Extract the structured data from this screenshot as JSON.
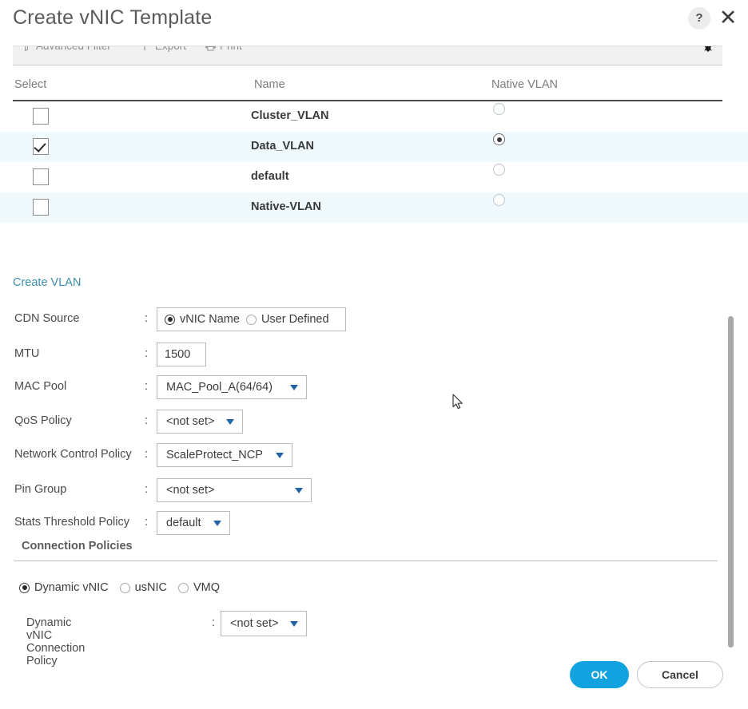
{
  "dialog": {
    "title": "Create vNIC Template",
    "help_icon": "help-circle-icon",
    "help_glyph": "?",
    "close_icon": "close-icon",
    "close_glyph": "✕"
  },
  "toolbar": {
    "advanced_filter": "Advanced Filter",
    "export": "Export",
    "print": "Print",
    "settings_icon": "column-settings-icon"
  },
  "table": {
    "columns": [
      "Select",
      "Name",
      "Native VLAN"
    ],
    "rows": [
      {
        "name": "Cluster_VLAN",
        "selected": false,
        "native": false
      },
      {
        "name": "Data_VLAN",
        "selected": true,
        "native": true
      },
      {
        "name": "default",
        "selected": false,
        "native": false
      },
      {
        "name": "Native-VLAN",
        "selected": false,
        "native": false
      }
    ]
  },
  "links": {
    "create_vlan": "Create VLAN"
  },
  "form": {
    "colon": ":",
    "cdn_source": {
      "label": "CDN Source",
      "options": [
        "vNIC Name",
        "User Defined"
      ],
      "selected": "vNIC Name"
    },
    "mtu": {
      "label": "MTU",
      "value": "1500"
    },
    "mac_pool": {
      "label": "MAC Pool",
      "value": "MAC_Pool_A(64/64)"
    },
    "qos_policy": {
      "label": "QoS Policy",
      "value": "<not set>"
    },
    "network_control_policy": {
      "label": "Network Control Policy",
      "value": "ScaleProtect_NCP"
    },
    "pin_group": {
      "label": "Pin Group",
      "value": "<not set>"
    },
    "stats_threshold_policy": {
      "label": "Stats Threshold Policy",
      "value": "default"
    }
  },
  "connection_policies": {
    "title": "Connection Policies",
    "options": [
      "Dynamic vNIC",
      "usNIC",
      "VMQ"
    ],
    "selected": "Dynamic vNIC",
    "dynamic_vnic_connection_policy": {
      "label": "Dynamic vNIC Connection Policy",
      "value": "<not set>"
    }
  },
  "footer": {
    "ok": "OK",
    "cancel": "Cancel"
  },
  "colors": {
    "accent_blue": "#13a2e0",
    "link_blue": "#3e8eab",
    "row_stripe": "#f0fafd",
    "caret_blue": "#1f63a8"
  }
}
